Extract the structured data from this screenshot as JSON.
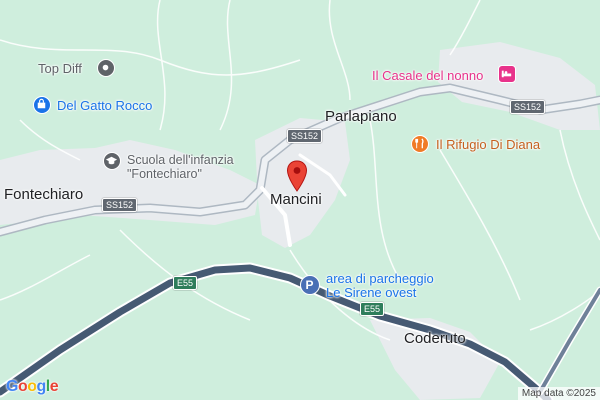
{
  "map": {
    "places": {
      "top_diff": "Top Diff",
      "del_gatto_rocco": "Del Gatto Rocco",
      "scuola_line1": "Scuola dell'infanzia",
      "scuola_line2": "\"Fontechiaro\"",
      "fontechiaro": "Fontechiaro",
      "parlapiano": "Parlapiano",
      "mancini": "Mancini",
      "casale": "Il Casale del nonno",
      "rifugio": "Il Rifugio Di Diana",
      "parcheggio_line1": "area di parcheggio",
      "parcheggio_line2": "Le Sirene ovest",
      "coderuto": "Coderuto"
    },
    "road_shields": {
      "ss152_left": "SS152",
      "ss152_center": "SS152",
      "ss152_right": "SS152",
      "e55_left": "E55",
      "e55_right": "E55"
    },
    "icons": {
      "top_diff": "place-icon",
      "del_gatto_rocco": "shopping-bag-icon",
      "scuola": "school-icon",
      "casale": "hotel-bed-icon",
      "rifugio": "restaurant-icon",
      "parcheggio": "parking-icon",
      "selected": "red-map-pin-icon"
    },
    "attribution": "Map data ©2025",
    "logo": "Google",
    "colors": {
      "land": "#cfeedd",
      "urban": "#e8ebee",
      "road_main": "#b9c3cd",
      "motorway": "#465a73",
      "pin": "#ea4335",
      "pink_label": "#e8338b",
      "orange_label": "#c5601f",
      "blue_label": "#1a73e8"
    }
  }
}
